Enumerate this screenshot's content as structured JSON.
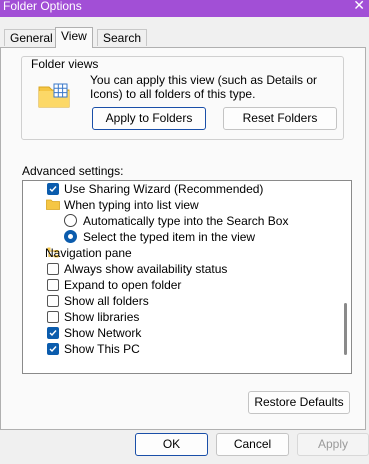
{
  "window": {
    "title": "Folder Options",
    "close_glyph": "✕"
  },
  "tabs": [
    {
      "label": "General",
      "active": false
    },
    {
      "label": "View",
      "active": true
    },
    {
      "label": "Search",
      "active": false
    }
  ],
  "folder_views": {
    "legend": "Folder views",
    "description": "You can apply this view (such as Details or Icons) to all folders of this type.",
    "apply_button": "Apply to Folders",
    "reset_button": "Reset Folders",
    "icon": "folder-grid-icon"
  },
  "advanced": {
    "label": "Advanced settings:",
    "items": [
      {
        "kind": "checkbox",
        "label": "Use Sharing Wizard (Recommended)",
        "checked": true
      },
      {
        "kind": "folder",
        "label": "When typing into list view"
      },
      {
        "kind": "radio",
        "label": "Automatically type into the Search Box",
        "selected": false
      },
      {
        "kind": "radio",
        "label": "Select the typed item in the view",
        "selected": true
      },
      {
        "kind": "nav",
        "label": "Navigation pane"
      },
      {
        "kind": "checkbox",
        "label": "Always show availability status",
        "checked": false
      },
      {
        "kind": "checkbox",
        "label": "Expand to open folder",
        "checked": false
      },
      {
        "kind": "checkbox",
        "label": "Show all folders",
        "checked": false
      },
      {
        "kind": "checkbox",
        "label": "Show libraries",
        "checked": false
      },
      {
        "kind": "checkbox",
        "label": "Show Network",
        "checked": true
      },
      {
        "kind": "checkbox",
        "label": "Show This PC",
        "checked": true
      }
    ],
    "restore_button": "Restore Defaults"
  },
  "footer": {
    "ok": "OK",
    "cancel": "Cancel",
    "apply": "Apply"
  },
  "colors": {
    "titlebar": "#a24fd6",
    "accent": "#0b5cad"
  }
}
